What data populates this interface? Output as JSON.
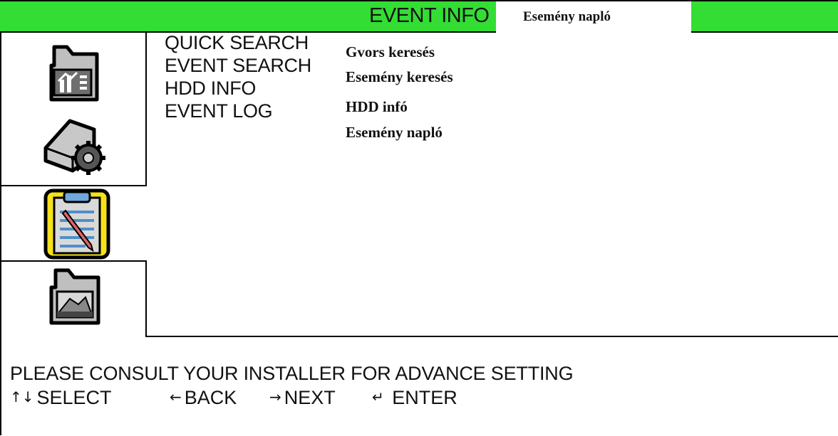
{
  "header": {
    "title": "EVENT INFO",
    "annotation": "Esemény napló",
    "bar_color": "#33dd33"
  },
  "sidebar": {
    "tabs": [
      {
        "icon": "chart-folder-icon",
        "active": false
      },
      {
        "icon": "hdd-gear-icon",
        "active": false
      },
      {
        "icon": "clipboard-icon",
        "active": true
      },
      {
        "icon": "network-folder-icon",
        "active": false
      }
    ],
    "active_color": "#f5e21a"
  },
  "menu": {
    "items": [
      {
        "label": "QUICK SEARCH",
        "annotation": "Gvors keresés"
      },
      {
        "label": "EVENT SEARCH",
        "annotation": "Esemény keresés"
      },
      {
        "label": "HDD INFO",
        "annotation": "HDD infó"
      },
      {
        "label": "EVENT LOG",
        "annotation": "Esemény napló"
      }
    ]
  },
  "footer": {
    "notice": "PLEASE CONSULT YOUR INSTALLER FOR ADVANCE SETTING",
    "hints": [
      {
        "glyph": "↑↓",
        "label": "SELECT"
      },
      {
        "glyph": "←",
        "label": "BACK"
      },
      {
        "glyph": "→",
        "label": "NEXT"
      },
      {
        "glyph": "↵",
        "label": "ENTER"
      }
    ]
  }
}
